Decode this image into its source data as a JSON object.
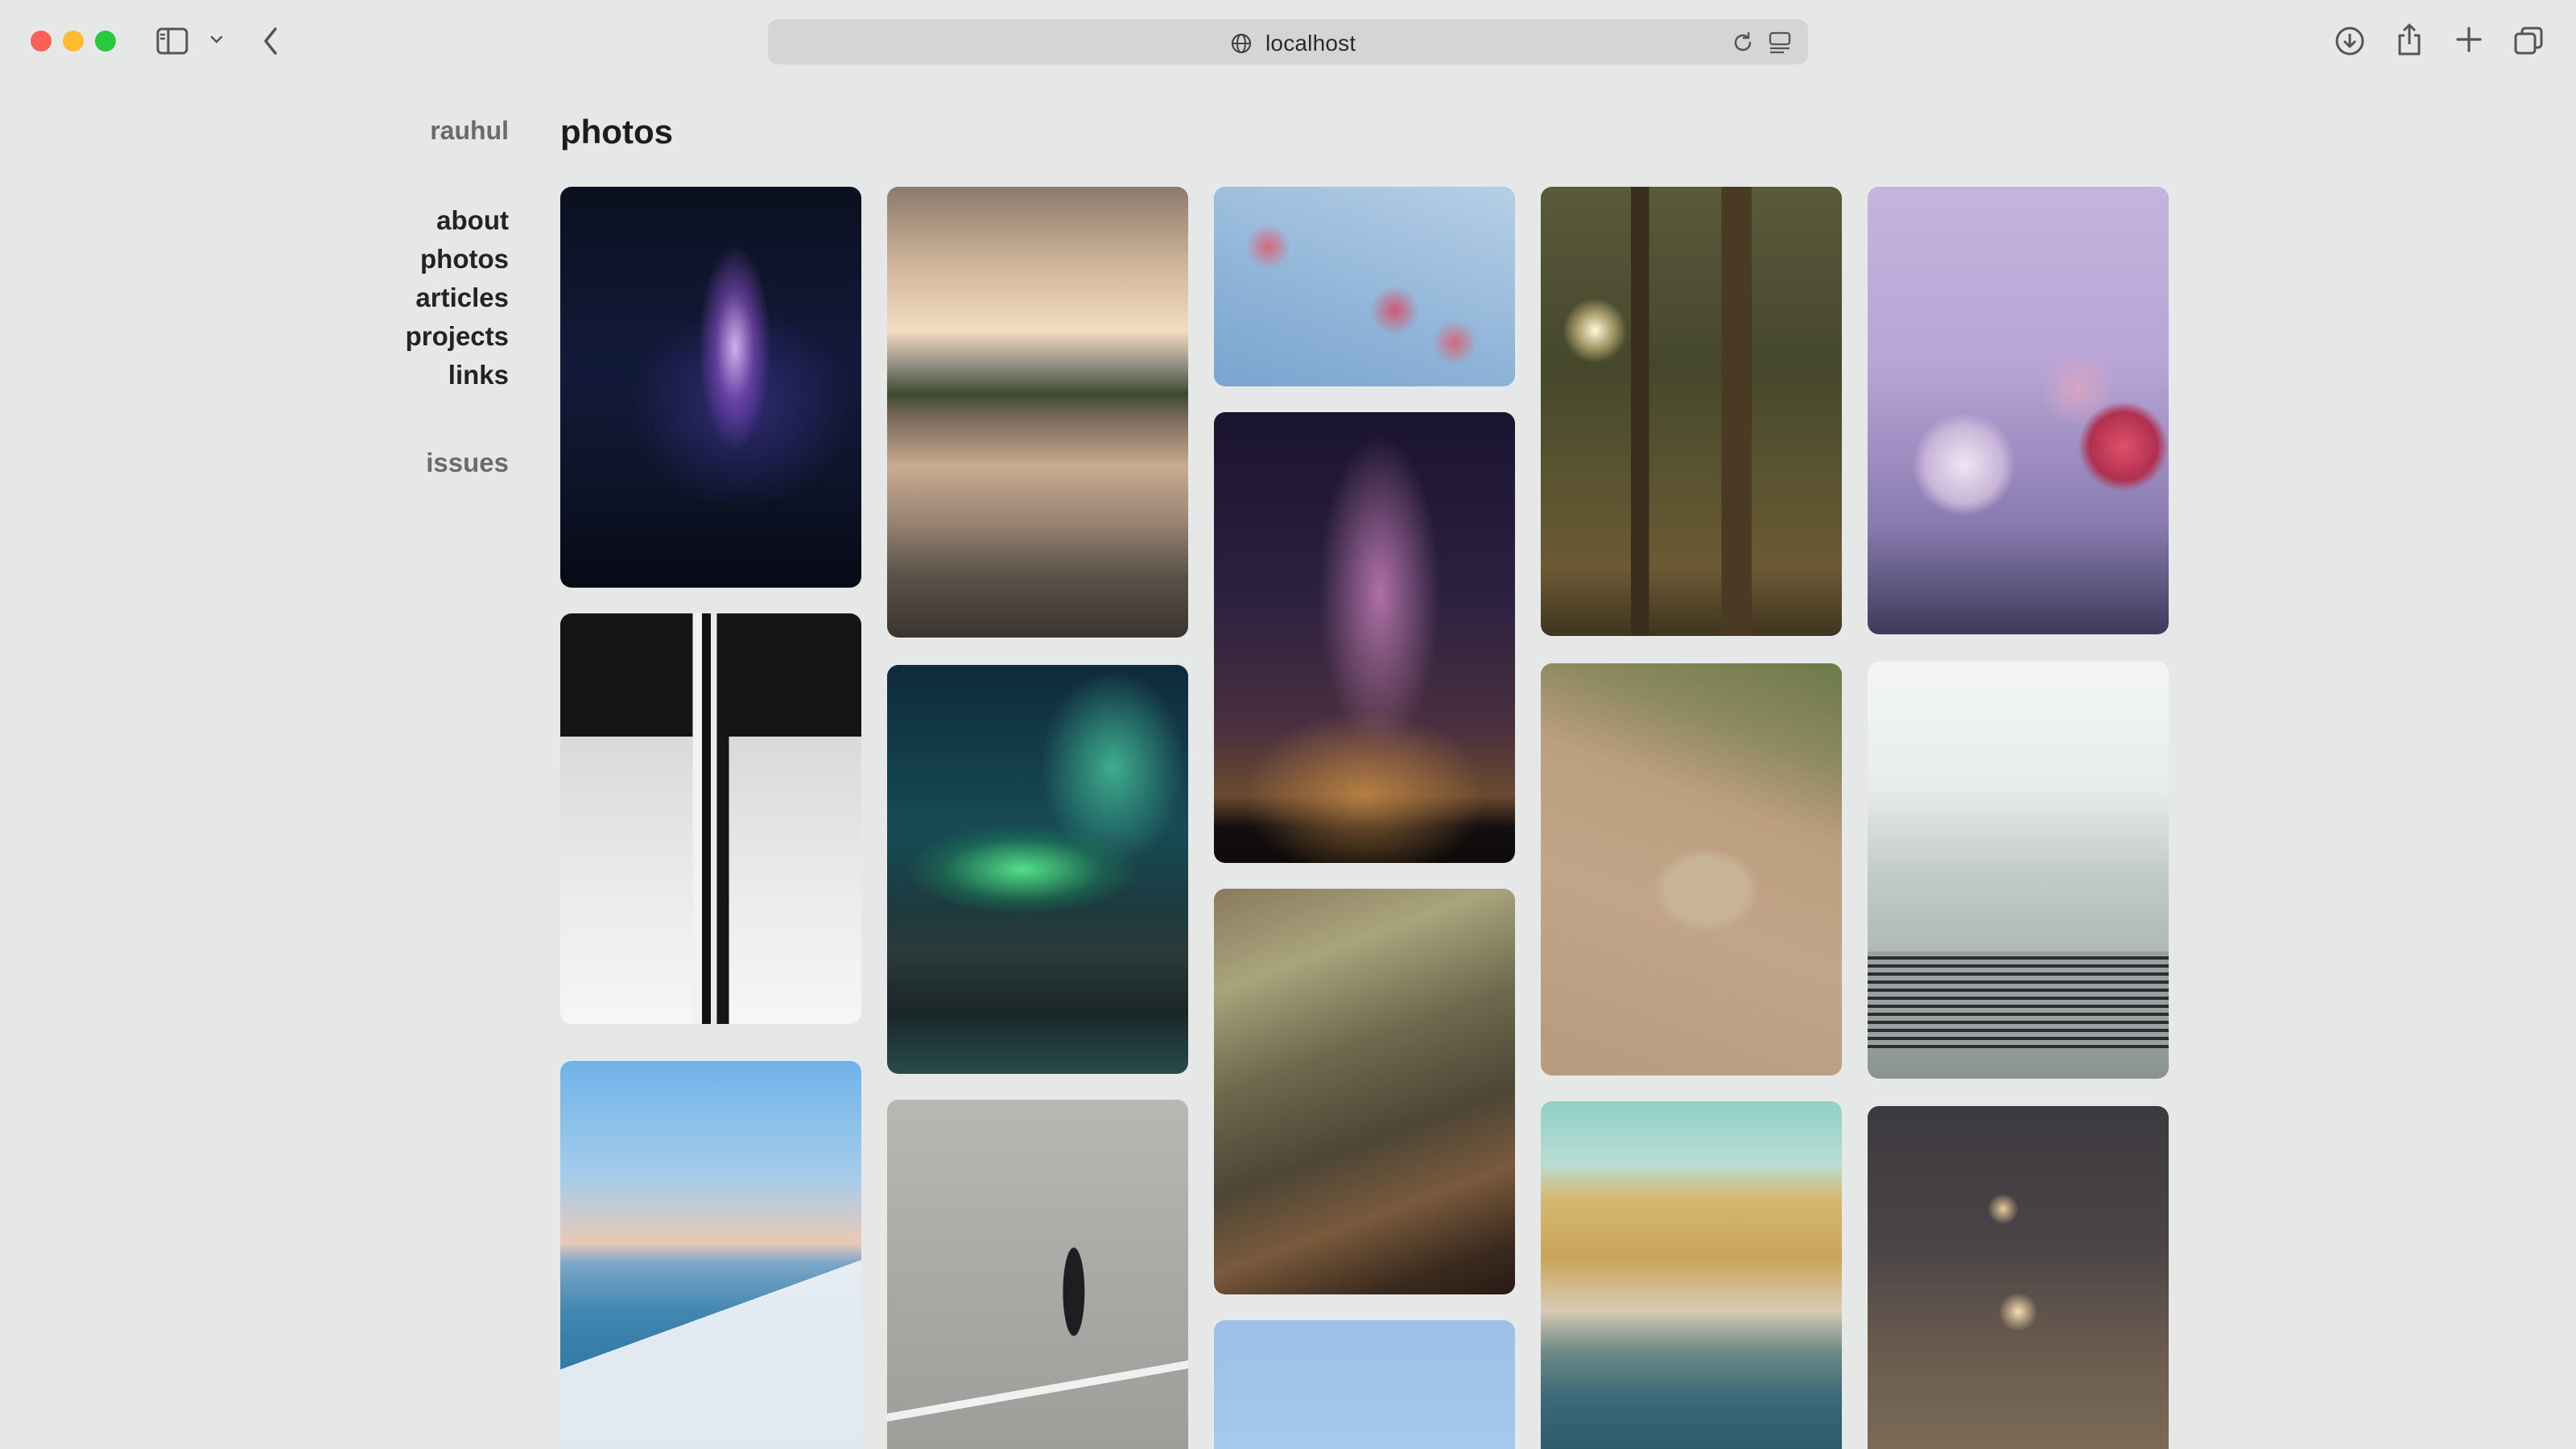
{
  "browser": {
    "url": "localhost",
    "icons": [
      "close-button",
      "minimize-button",
      "maximize-button",
      "sidebar-icon",
      "chevron-down-icon",
      "back-icon",
      "globe-icon",
      "reload-icon",
      "reader-icon",
      "download-icon",
      "share-icon",
      "plus-icon",
      "tabs-icon"
    ]
  },
  "site": {
    "name": "rauhul",
    "nav": [
      "about",
      "photos",
      "articles",
      "projects",
      "links"
    ],
    "issues": "issues"
  },
  "page": {
    "title": "photos"
  },
  "photos": [
    {
      "subject": "purple light beam in darkness"
    },
    {
      "subject": "mountain lake reflection under cloudy sky"
    },
    {
      "subject": "pink flowers against blue sky"
    },
    {
      "subject": "sunlit pine forest"
    },
    {
      "subject": "frosted berries"
    },
    {
      "subject": "black and white architecture"
    },
    {
      "subject": "green aurora over mountains"
    },
    {
      "subject": "milky way with silhouette"
    },
    {
      "subject": "leopard on dirt road"
    },
    {
      "subject": "vintage Continental car grille"
    },
    {
      "subject": "mossy tree trunk"
    },
    {
      "subject": "ocean horizon with cliff"
    },
    {
      "subject": "man in suit walking on road"
    },
    {
      "subject": "blue sky"
    },
    {
      "subject": "canal town with boats"
    },
    {
      "subject": "foggy street lights at night"
    }
  ]
}
